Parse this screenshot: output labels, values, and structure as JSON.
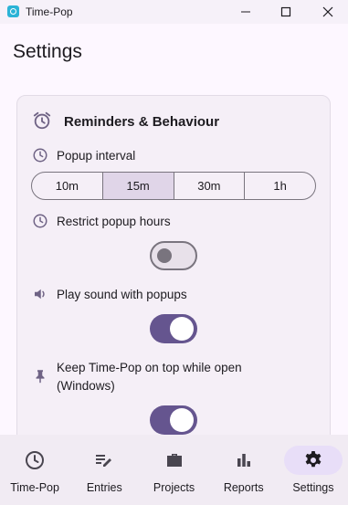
{
  "window": {
    "title": "Time-Pop",
    "controls": [
      "minimize",
      "maximize",
      "close"
    ]
  },
  "page": {
    "title": "Settings"
  },
  "reminders": {
    "title": "Reminders & Behaviour",
    "popup_interval": {
      "label": "Popup interval",
      "options": [
        "10m",
        "15m",
        "30m",
        "1h"
      ],
      "selected": "15m"
    },
    "restrict_hours": {
      "label": "Restrict popup hours",
      "enabled": false
    },
    "play_sound": {
      "label": "Play sound with popups",
      "enabled": true
    },
    "keep_on_top": {
      "label": "Keep Time-Pop on top while open (Windows)",
      "enabled": true
    }
  },
  "nav": {
    "items": [
      {
        "label": "Time-Pop",
        "icon": "clock-icon"
      },
      {
        "label": "Entries",
        "icon": "edit-list-icon"
      },
      {
        "label": "Projects",
        "icon": "briefcase-icon"
      },
      {
        "label": "Reports",
        "icon": "bar-chart-icon"
      },
      {
        "label": "Settings",
        "icon": "gear-icon"
      }
    ],
    "active": "Settings"
  },
  "colors": {
    "accent": "#65558f",
    "icon": "#6f6385",
    "background": "#fdf7ff",
    "card": "#f5eff7",
    "selected_segment": "#e0d5e8",
    "nav_active_pill": "#e8def8"
  }
}
